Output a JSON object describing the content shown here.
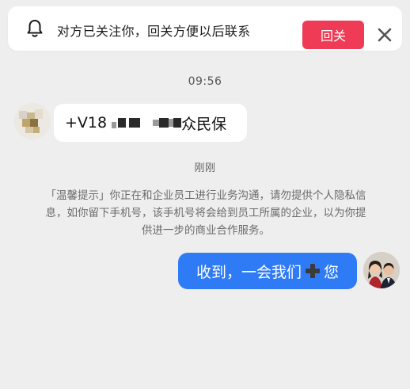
{
  "banner": {
    "message": "对方已关注你，回关方便以后联系",
    "follow_back_label": "回关",
    "icon": "bell-icon",
    "close_icon": "close-icon"
  },
  "chat": {
    "timestamp_1": "09:56",
    "incoming": {
      "prefix": "+V18",
      "suffix": "众民保"
    },
    "timestamp_2": "刚刚",
    "system_notice": "「温馨提示」你正在和企业员工进行业务沟通，请勿提供个人隐私信息，如你留下手机号，该手机号将会给到员工所属的企业，以为你提供进一步的商业合作服务。",
    "outgoing": {
      "before_icon": "收到，一会我们",
      "icon": "plus-icon",
      "after_icon": "您"
    }
  },
  "colors": {
    "background": "#eeeeef",
    "follow_back_button": "#ef3b56",
    "outgoing_bubble": "#2f7bf6",
    "notice_text": "#6b6b6b"
  }
}
